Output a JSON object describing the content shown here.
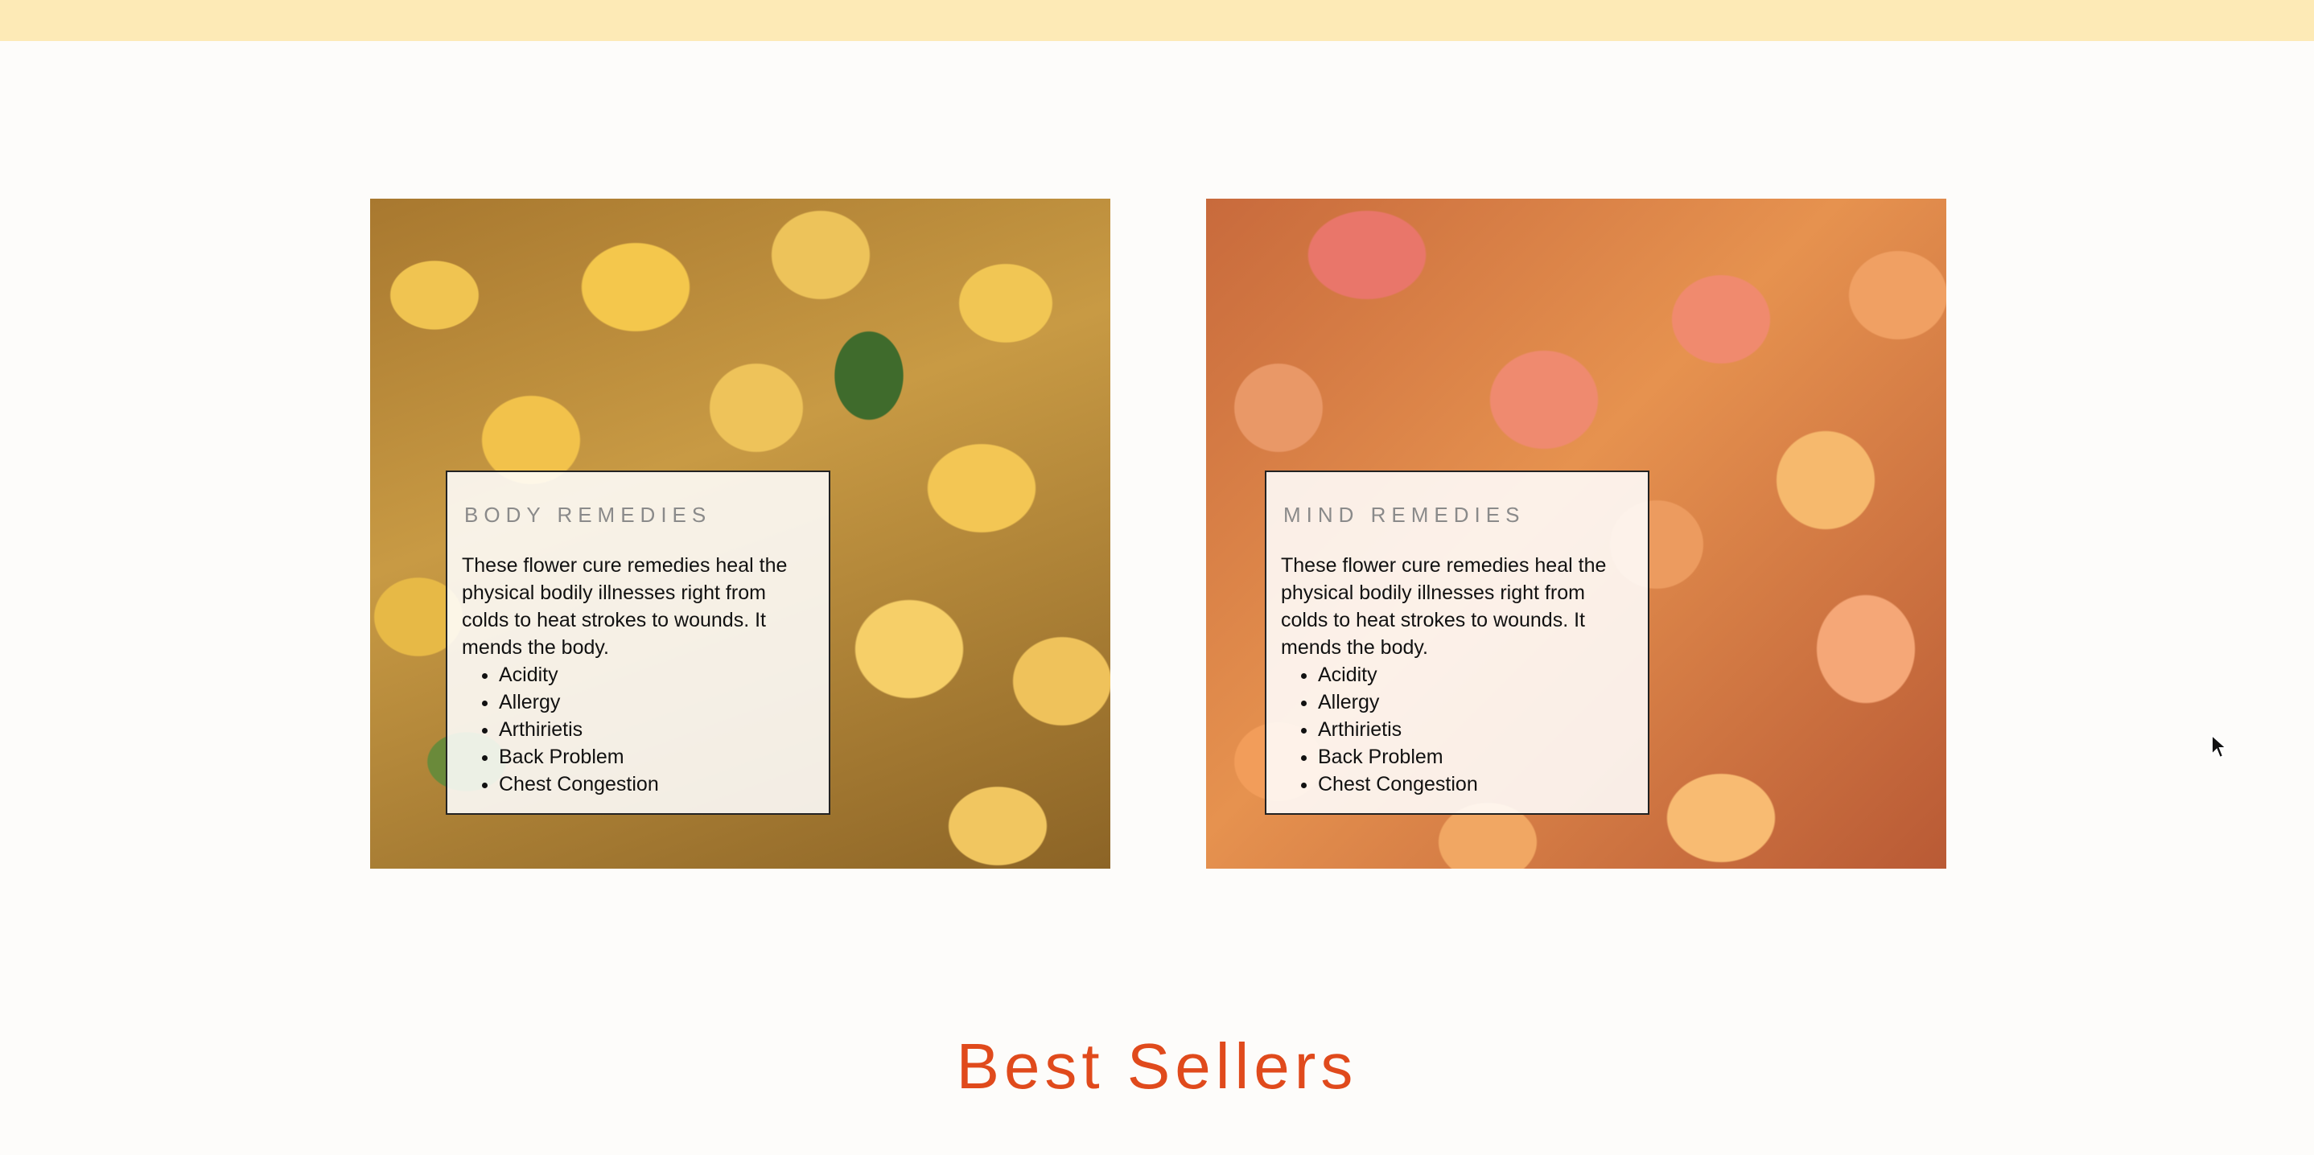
{
  "cards": [
    {
      "image": "lemons-photo",
      "title": "BODY REMEDIES",
      "description": "These flower cure remedies heal the physical bodily illnesses right from colds to heat strokes to wounds. It mends the body.",
      "items": [
        "Acidity",
        "Allergy",
        "Arthirietis",
        "Back Problem",
        "Chest Congestion"
      ]
    },
    {
      "image": "apricots-photo",
      "title": "MIND REMEDIES",
      "description": "These flower cure remedies heal the physical bodily illnesses right from colds to heat strokes to wounds. It mends the body.",
      "items": [
        "Acidity",
        "Allergy",
        "Arthirietis",
        "Back Problem",
        "Chest Congestion"
      ]
    }
  ],
  "section_heading": "Best Sellers",
  "colors": {
    "banner": "#fdeab6",
    "background": "#fdfcfa",
    "heading": "#e04a1c"
  }
}
